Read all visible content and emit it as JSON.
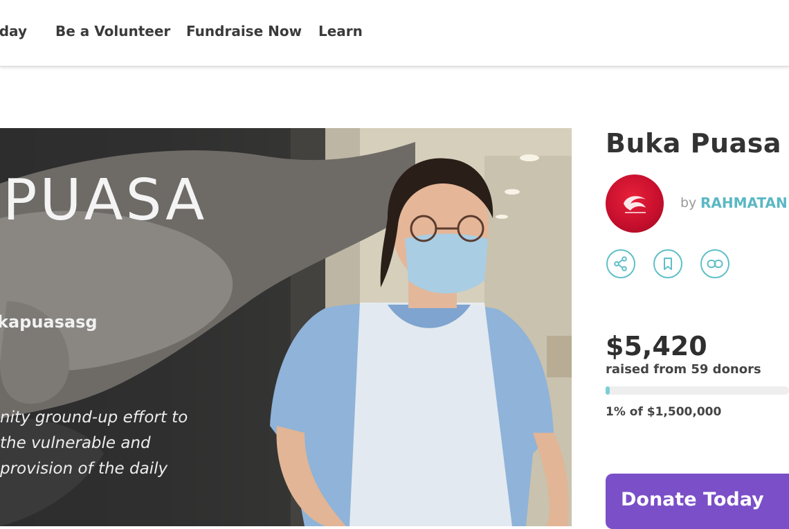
{
  "nav": {
    "items": [
      {
        "label": "oday"
      },
      {
        "label": "Be a Volunteer"
      },
      {
        "label": "Fundraise Now"
      },
      {
        "label": "Learn"
      }
    ]
  },
  "hero": {
    "title": "PUASA",
    "tag": "kapuasasg",
    "copy_lines": [
      "nity ground-up effort to",
      "the vulnerable and",
      "provision of the daily"
    ]
  },
  "campaign": {
    "title": "Buka Puasa F",
    "by_label": "by",
    "organizer": "RAHMATAN",
    "actions": [
      "share-icon",
      "bookmark-icon",
      "link-icon"
    ],
    "raised_amount": "$5,420",
    "raised_sub": "raised from 59 donors",
    "progress_fraction": 0.01,
    "percent_line": "1% of $1,500,000",
    "donate_label": "Donate Today"
  },
  "colors": {
    "accent_teal": "#5bb8c4",
    "donate_purple": "#7a4fc7",
    "logo_red": "#c8102e"
  }
}
